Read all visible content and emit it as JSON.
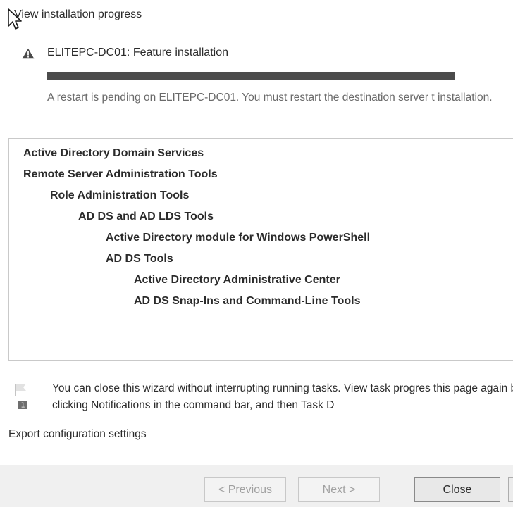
{
  "page": {
    "heading": "View installation progress"
  },
  "status": {
    "icon": "warning-icon",
    "title": "ELITEPC-DC01: Feature installation",
    "progress": 1.0,
    "progress_color": "#4b4b4b",
    "message": "A restart is pending on ELITEPC-DC01. You must restart the destination server t installation."
  },
  "features": [
    {
      "label": "Active Directory Domain Services",
      "level": 0
    },
    {
      "label": "Remote Server Administration Tools",
      "level": 0
    },
    {
      "label": "Role Administration Tools",
      "level": 1
    },
    {
      "label": "AD DS and AD LDS Tools",
      "level": 2
    },
    {
      "label": "Active Directory module for Windows PowerShell",
      "level": 3
    },
    {
      "label": "AD DS Tools",
      "level": 3
    },
    {
      "label": "Active Directory Administrative Center",
      "level": 4
    },
    {
      "label": "AD DS Snap-Ins and Command-Line Tools",
      "level": 4
    }
  ],
  "notice": {
    "icon": "notification-flag-icon",
    "badge": "1",
    "text": "You can close this wizard without interrupting running tasks. View task progres this page again by clicking Notifications in the command bar, and then Task D"
  },
  "export_link": "Export configuration settings",
  "buttons": {
    "previous": "< Previous",
    "next": "Next >",
    "close": "Close"
  }
}
